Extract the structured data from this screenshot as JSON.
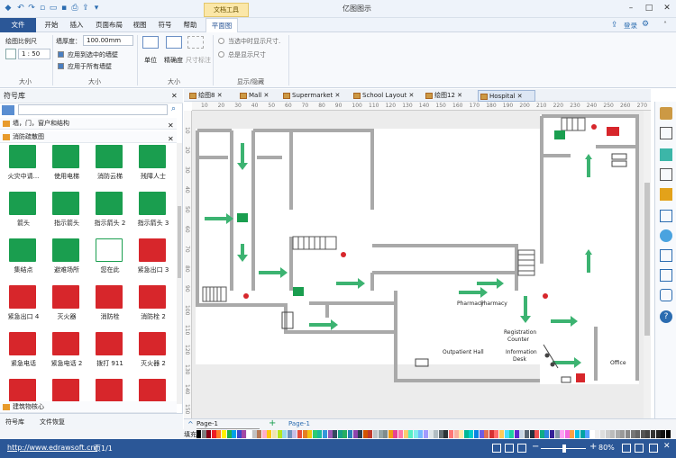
{
  "app_title": "亿图图示",
  "context_tab_group": "文档工具",
  "ribbon_tabs": [
    "文件",
    "开始",
    "插入",
    "页面布局",
    "视图",
    "符号",
    "帮助",
    "平面图"
  ],
  "login": "登录",
  "ribbon": {
    "scale_label": "绘图比例尺",
    "scale_value": "1 : 50",
    "wall_label": "墙厚度：",
    "wall_value": "100.00mm",
    "apply_selected": "应用到选中的墙壁",
    "apply_all": "应用于所有墙壁",
    "unit": "单位",
    "precision": "精确度",
    "dim_mark": "尺寸标注",
    "opt_selected": "当选中时显示尺寸.",
    "opt_always": "总是显示尺寸",
    "group_size1": "大小",
    "group_size2": "大小",
    "group_size3": "大小",
    "group_show": "显示/隐藏"
  },
  "library": {
    "title": "符号库",
    "cat_walls": "墙，门，窗户和结构",
    "cat_fire": "消防疏散图",
    "cat_building": "建筑物核心",
    "symbols": [
      {
        "label": "火灾中请...",
        "color": "#1a9e4f",
        "icon": "fire-stairs-icon"
      },
      {
        "label": "使用电梯",
        "color": "#1a9e4f",
        "icon": "elevator-icon"
      },
      {
        "label": "消防云梯",
        "color": "#1a9e4f",
        "icon": "ladder-icon"
      },
      {
        "label": "残障人士",
        "color": "#1a9e4f",
        "icon": "wheelchair-icon"
      },
      {
        "label": "箭头",
        "color": "#1a9e4f",
        "icon": "arrow-right-icon"
      },
      {
        "label": "指示箭头",
        "color": "#1a9e4f",
        "icon": "arrow-left-icon"
      },
      {
        "label": "指示箭头 2",
        "color": "#1a9e4f",
        "icon": "arrow-diag-icon"
      },
      {
        "label": "指示箭头 3",
        "color": "#1a9e4f",
        "icon": "arrow-diag2-icon"
      },
      {
        "label": "集结点",
        "color": "#1a9e4f",
        "icon": "assembly-point-icon"
      },
      {
        "label": "避难场所",
        "color": "#1a9e4f",
        "icon": "shelter-icon"
      },
      {
        "label": "您在此",
        "color": "#ffffff",
        "icon": "you-are-here-icon"
      },
      {
        "label": "紧急出口 3",
        "color": "#d7262b",
        "icon": "exit-icon"
      },
      {
        "label": "紧急出口 4",
        "color": "#d7262b",
        "icon": "wheelchair-exit-icon"
      },
      {
        "label": "灭火器",
        "color": "#d7262b",
        "icon": "extinguisher-icon"
      },
      {
        "label": "消防栓",
        "color": "#d7262b",
        "icon": "hydrant-icon"
      },
      {
        "label": "消防栓 2",
        "color": "#d7262b",
        "icon": "hydrant2-icon"
      },
      {
        "label": "紧急电话",
        "color": "#d7262b",
        "icon": "phone-icon"
      },
      {
        "label": "紧急电话 2",
        "color": "#d7262b",
        "icon": "dial-icon"
      },
      {
        "label": "拨打 911",
        "color": "#d7262b",
        "icon": "dial911-icon"
      },
      {
        "label": "灭火器 2",
        "color": "#d7262b",
        "icon": "extinguisher2-icon"
      },
      {
        "label": "",
        "color": "#d7262b",
        "icon": "fire-alarm-icon"
      },
      {
        "label": "",
        "color": "#d7262b",
        "icon": "hose-icon"
      },
      {
        "label": "",
        "color": "#d7262b",
        "icon": "switch-icon"
      },
      {
        "label": "",
        "color": "#d7262b",
        "icon": "fire-door-icon"
      }
    ],
    "bottom_tabs": [
      "符号库",
      "文件恢复"
    ]
  },
  "doc_tabs": [
    "绘图8",
    "Mall",
    "Supermarket",
    "School Layout",
    "绘图12",
    "Hospital"
  ],
  "ruler_top": [
    "10",
    "20",
    "30",
    "40",
    "50",
    "60",
    "70",
    "80",
    "90",
    "100",
    "110",
    "120",
    "130",
    "140",
    "150",
    "160",
    "170",
    "180",
    "190",
    "200",
    "210",
    "220",
    "230",
    "240",
    "250",
    "260",
    "270"
  ],
  "ruler_left": [
    "10",
    "20",
    "30",
    "40",
    "50",
    "60",
    "70",
    "80",
    "90",
    "100",
    "110",
    "120",
    "130",
    "140",
    "150"
  ],
  "plan_labels": {
    "pharmacy1": "Pharmacy",
    "pharmacy2": "Pharmacy",
    "registration1": "Registration",
    "registration2": "Counter",
    "info1": "Information",
    "info2": "Desk",
    "outpatient": "Outpatient Hall",
    "office": "Office"
  },
  "page_bar": {
    "page1": "Page-1",
    "page1_active": "Page-1"
  },
  "fill_label": "填充",
  "palette": [
    "#000000",
    "#7f7f7f",
    "#880015",
    "#ed1c24",
    "#ff7f27",
    "#fff200",
    "#22b14c",
    "#00a2e8",
    "#3f48cc",
    "#a349a4",
    "#ffffff",
    "#c3c3c3",
    "#b97a57",
    "#ffaec9",
    "#ffc90e",
    "#efe4b0",
    "#b5e61d",
    "#99d9ea",
    "#7092be",
    "#c8bfe7",
    "#e74c3c",
    "#e67e22",
    "#f1c40f",
    "#2ecc71",
    "#1abc9c",
    "#3498db",
    "#9b59b6",
    "#34495e",
    "#16a085",
    "#27ae60",
    "#2980b9",
    "#8e44ad",
    "#2c3e50",
    "#d35400",
    "#c0392b",
    "#bdc3c7",
    "#95a5a6",
    "#7f8c8d",
    "#f39c12",
    "#e84393",
    "#fd79a8",
    "#fdcb6e",
    "#55efc4",
    "#81ecec",
    "#74b9ff",
    "#a29bfe",
    "#dfe6e9",
    "#b2bec3",
    "#636e72",
    "#2d3436",
    "#ff7675",
    "#fab1a0",
    "#ffeaa7",
    "#00b894",
    "#00cec9",
    "#0984e3",
    "#6c5ce7",
    "#e17055",
    "#d63031",
    "#ff6b6b",
    "#feca57",
    "#48dbfb",
    "#1dd1a1",
    "#5f27cd",
    "#c8d6e5",
    "#576574",
    "#222f3e",
    "#ee5253",
    "#10ac84",
    "#2e86de",
    "#341f97",
    "#8395a7",
    "#ff9ff3",
    "#f368e0",
    "#ff9f43",
    "#0abde3",
    "#01a3a4",
    "#54a0ff",
    "#ffffff",
    "#eeeeee",
    "#dddddd",
    "#cccccc",
    "#bbbbbb",
    "#aaaaaa",
    "#999999",
    "#888888",
    "#777777",
    "#666666",
    "#555555",
    "#444444",
    "#333333",
    "#222222",
    "#111111",
    "#000000"
  ],
  "status": {
    "url": "http://www.edrawsoft.cn/",
    "page": "页1/1",
    "zoom": "80%"
  }
}
